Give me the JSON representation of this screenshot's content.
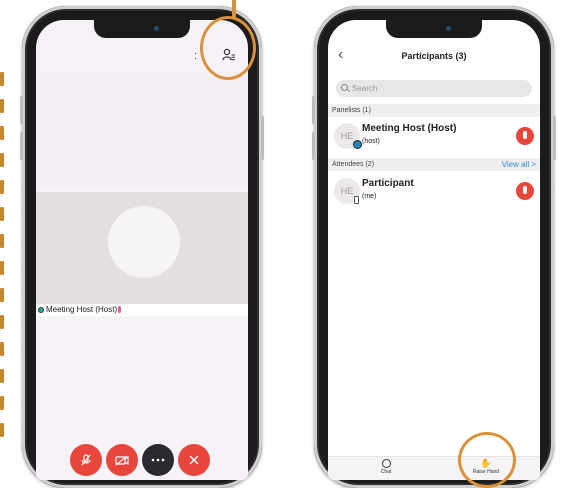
{
  "left_phone": {
    "participants_icon": "participants-list-icon",
    "top_right_small": ":",
    "name_label": "Meeting Host (Host)",
    "controls": [
      {
        "name": "mute-button",
        "icon": "mic-off-icon",
        "glyph": "✕"
      },
      {
        "name": "video-button",
        "icon": "video-off-icon",
        "glyph": "▭"
      },
      {
        "name": "more-button",
        "icon": "more-icon",
        "glyph": "···"
      },
      {
        "name": "leave-button",
        "icon": "close-icon",
        "glyph": "✕"
      }
    ]
  },
  "right_phone": {
    "back_glyph": "‹",
    "title": "Participants (3)",
    "search_placeholder": "Search",
    "panelists_header": "Panelists (1)",
    "attendees_header": "Attendees (2)",
    "view_all": "View all >",
    "panelists": [
      {
        "initials": "HE",
        "name": "Meeting Host (Host)",
        "sub": "(host)"
      }
    ],
    "attendees": [
      {
        "initials": "HE",
        "name": "Participant",
        "sub": "(me)"
      }
    ],
    "tabs": {
      "chat": "Chat",
      "raise_hand": "Raise Hand"
    }
  },
  "colors": {
    "accent_orange": "#d9913a",
    "mic_red": "#e8463d",
    "link_blue": "#2c8fd6"
  }
}
